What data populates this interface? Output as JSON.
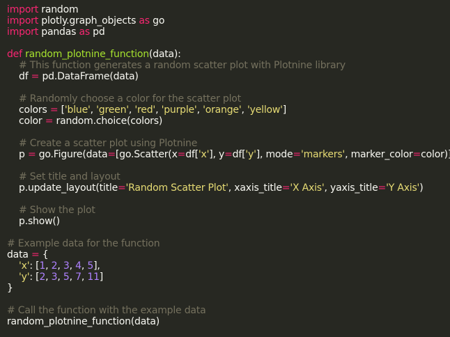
{
  "editor": {
    "background": "#272822",
    "token_colors": {
      "kw": "#f92672",
      "fn": "#a6e22e",
      "str": "#e6db74",
      "num": "#ae81ff",
      "cm": "#75715e",
      "pl": "#f8f8f2",
      "op": "#f92672"
    },
    "lines": [
      [
        [
          "kw",
          "import"
        ],
        [
          "pl",
          " random"
        ]
      ],
      [
        [
          "kw",
          "import"
        ],
        [
          "pl",
          " plotly.graph_objects "
        ],
        [
          "kw",
          "as"
        ],
        [
          "pl",
          " go"
        ]
      ],
      [
        [
          "kw",
          "import"
        ],
        [
          "pl",
          " pandas "
        ],
        [
          "kw",
          "as"
        ],
        [
          "pl",
          " pd"
        ]
      ],
      [],
      [
        [
          "kw",
          "def"
        ],
        [
          "pl",
          " "
        ],
        [
          "fn",
          "random_plotnine_function"
        ],
        [
          "pl",
          "(data):"
        ]
      ],
      [
        [
          "pl",
          "    "
        ],
        [
          "cm",
          "# This function generates a random scatter plot with Plotnine library"
        ]
      ],
      [
        [
          "pl",
          "    df "
        ],
        [
          "op",
          "="
        ],
        [
          "pl",
          " pd.DataFrame(data)"
        ]
      ],
      [],
      [
        [
          "pl",
          "    "
        ],
        [
          "cm",
          "# Randomly choose a color for the scatter plot"
        ]
      ],
      [
        [
          "pl",
          "    colors "
        ],
        [
          "op",
          "="
        ],
        [
          "pl",
          " ["
        ],
        [
          "str",
          "'blue'"
        ],
        [
          "pl",
          ", "
        ],
        [
          "str",
          "'green'"
        ],
        [
          "pl",
          ", "
        ],
        [
          "str",
          "'red'"
        ],
        [
          "pl",
          ", "
        ],
        [
          "str",
          "'purple'"
        ],
        [
          "pl",
          ", "
        ],
        [
          "str",
          "'orange'"
        ],
        [
          "pl",
          ", "
        ],
        [
          "str",
          "'yellow'"
        ],
        [
          "pl",
          "]"
        ]
      ],
      [
        [
          "pl",
          "    color "
        ],
        [
          "op",
          "="
        ],
        [
          "pl",
          " random.choice(colors)"
        ]
      ],
      [],
      [
        [
          "pl",
          "    "
        ],
        [
          "cm",
          "# Create a scatter plot using Plotnine"
        ]
      ],
      [
        [
          "pl",
          "    p "
        ],
        [
          "op",
          "="
        ],
        [
          "pl",
          " go.Figure(data"
        ],
        [
          "op",
          "="
        ],
        [
          "pl",
          "[go.Scatter(x"
        ],
        [
          "op",
          "="
        ],
        [
          "pl",
          "df["
        ],
        [
          "str",
          "'x'"
        ],
        [
          "pl",
          "], y"
        ],
        [
          "op",
          "="
        ],
        [
          "pl",
          "df["
        ],
        [
          "str",
          "'y'"
        ],
        [
          "pl",
          "], mode"
        ],
        [
          "op",
          "="
        ],
        [
          "str",
          "'markers'"
        ],
        [
          "pl",
          ", marker_color"
        ],
        [
          "op",
          "="
        ],
        [
          "pl",
          "color)])"
        ]
      ],
      [],
      [
        [
          "pl",
          "    "
        ],
        [
          "cm",
          "# Set title and layout"
        ]
      ],
      [
        [
          "pl",
          "    p.update_layout(title"
        ],
        [
          "op",
          "="
        ],
        [
          "str",
          "'Random Scatter Plot'"
        ],
        [
          "pl",
          ", xaxis_title"
        ],
        [
          "op",
          "="
        ],
        [
          "str",
          "'X Axis'"
        ],
        [
          "pl",
          ", yaxis_title"
        ],
        [
          "op",
          "="
        ],
        [
          "str",
          "'Y Axis'"
        ],
        [
          "pl",
          ")"
        ]
      ],
      [],
      [
        [
          "pl",
          "    "
        ],
        [
          "cm",
          "# Show the plot"
        ]
      ],
      [
        [
          "pl",
          "    p.show()"
        ]
      ],
      [],
      [
        [
          "cm",
          "# Example data for the function"
        ]
      ],
      [
        [
          "pl",
          "data "
        ],
        [
          "op",
          "="
        ],
        [
          "pl",
          " {"
        ]
      ],
      [
        [
          "pl",
          "    "
        ],
        [
          "str",
          "'x'"
        ],
        [
          "pl",
          ": ["
        ],
        [
          "num",
          "1"
        ],
        [
          "pl",
          ", "
        ],
        [
          "num",
          "2"
        ],
        [
          "pl",
          ", "
        ],
        [
          "num",
          "3"
        ],
        [
          "pl",
          ", "
        ],
        [
          "num",
          "4"
        ],
        [
          "pl",
          ", "
        ],
        [
          "num",
          "5"
        ],
        [
          "pl",
          "],"
        ]
      ],
      [
        [
          "pl",
          "    "
        ],
        [
          "str",
          "'y'"
        ],
        [
          "pl",
          ": ["
        ],
        [
          "num",
          "2"
        ],
        [
          "pl",
          ", "
        ],
        [
          "num",
          "3"
        ],
        [
          "pl",
          ", "
        ],
        [
          "num",
          "5"
        ],
        [
          "pl",
          ", "
        ],
        [
          "num",
          "7"
        ],
        [
          "pl",
          ", "
        ],
        [
          "num",
          "11"
        ],
        [
          "pl",
          "]"
        ]
      ],
      [
        [
          "pl",
          "}"
        ]
      ],
      [],
      [
        [
          "cm",
          "# Call the function with the example data"
        ]
      ],
      [
        [
          "pl",
          "random_plotnine_function(data)"
        ]
      ]
    ]
  }
}
